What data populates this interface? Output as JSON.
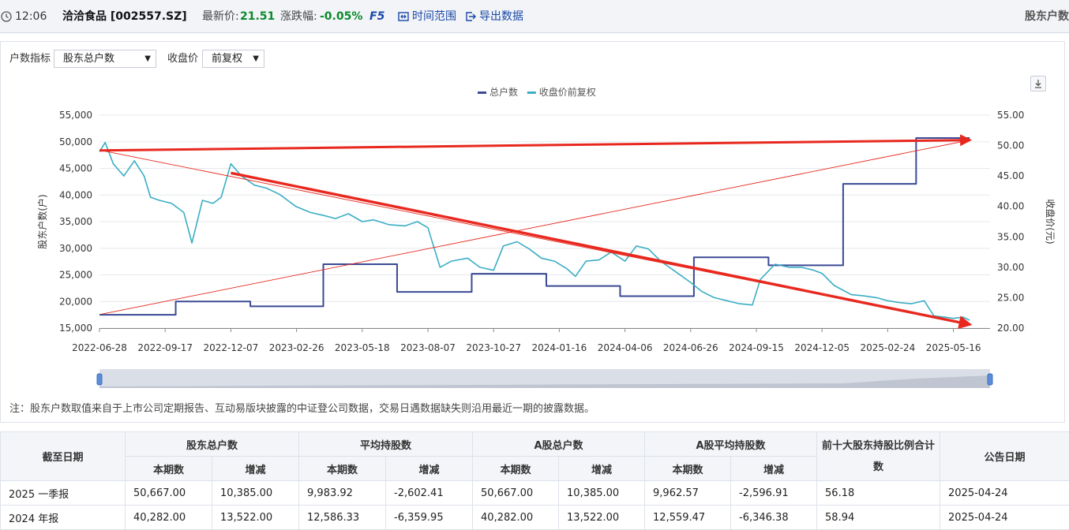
{
  "topbar": {
    "time": "12:06",
    "stock": "洽洽食品 [002557.SZ]",
    "latest_label": "最新价:",
    "latest_value": "21.51",
    "change_label": "涨跌幅:",
    "change_value": "-0.05%",
    "f5": "F5",
    "time_range": "时间范围",
    "export": "导出数据",
    "right_title": "股东户数"
  },
  "controls": {
    "metric_label": "户数指标",
    "metric_value": "股东总户数",
    "price_label": "收盘价",
    "price_value": "前复权"
  },
  "chart_data": {
    "type": "line",
    "legend": [
      "总户数",
      "收盘价前复权"
    ],
    "legend_position": "top-center",
    "ylabel_left": "股东户数(户)",
    "ylabel_right": "收盘价(元)",
    "yticks_left": [
      "55,000",
      "50,000",
      "45,000",
      "40,000",
      "35,000",
      "30,000",
      "25,000",
      "20,000",
      "15,000"
    ],
    "yticks_right": [
      "55.00",
      "50.00",
      "45.00",
      "40.00",
      "35.00",
      "30.00",
      "25.00",
      "20.00"
    ],
    "xticks": [
      "2022-06-28",
      "2022-09-17",
      "2022-12-07",
      "2023-02-26",
      "2023-05-18",
      "2023-08-07",
      "2023-10-27",
      "2024-01-16",
      "2024-04-06",
      "2024-06-26",
      "2024-09-15",
      "2024-12-05",
      "2025-02-24",
      "2025-05-16"
    ],
    "ylim_left": [
      15000,
      55000
    ],
    "ylim_right": [
      20,
      55
    ],
    "grid": true,
    "series": [
      {
        "name": "总户数",
        "axis": "left",
        "style": "step",
        "color": "#3a4a94",
        "points": [
          [
            "2022-06-28",
            17500
          ],
          [
            "2022-09-30",
            20000
          ],
          [
            "2022-12-31",
            19100
          ],
          [
            "2023-03-31",
            27000
          ],
          [
            "2023-06-30",
            21800
          ],
          [
            "2023-09-30",
            25200
          ],
          [
            "2023-12-31",
            22900
          ],
          [
            "2024-03-31",
            21000
          ],
          [
            "2024-06-30",
            28300
          ],
          [
            "2024-09-30",
            26800
          ],
          [
            "2024-12-31",
            42100
          ],
          [
            "2025-03-31",
            50700
          ],
          [
            "2025-06-05",
            50700
          ]
        ]
      },
      {
        "name": "收盘价前复权",
        "axis": "right",
        "color": "#3aaec4",
        "points": [
          [
            "2022-06-28",
            49.0
          ],
          [
            "2022-07-05",
            50.5
          ],
          [
            "2022-07-15",
            47.0
          ],
          [
            "2022-07-28",
            45.0
          ],
          [
            "2022-08-10",
            47.5
          ],
          [
            "2022-08-22",
            45.0
          ],
          [
            "2022-08-30",
            41.5
          ],
          [
            "2022-09-10",
            41.0
          ],
          [
            "2022-09-25",
            40.5
          ],
          [
            "2022-10-10",
            39.0
          ],
          [
            "2022-10-20",
            34.0
          ],
          [
            "2022-11-02",
            41.0
          ],
          [
            "2022-11-15",
            40.5
          ],
          [
            "2022-11-25",
            41.5
          ],
          [
            "2022-12-07",
            47.0
          ],
          [
            "2022-12-20",
            45.0
          ],
          [
            "2023-01-05",
            43.5
          ],
          [
            "2023-01-20",
            43.0
          ],
          [
            "2023-02-05",
            42.0
          ],
          [
            "2023-02-25",
            40.0
          ],
          [
            "2023-03-15",
            39.0
          ],
          [
            "2023-04-01",
            38.5
          ],
          [
            "2023-04-15",
            38.0
          ],
          [
            "2023-05-01",
            38.8
          ],
          [
            "2023-05-18",
            37.5
          ],
          [
            "2023-06-01",
            37.8
          ],
          [
            "2023-06-20",
            37.0
          ],
          [
            "2023-07-10",
            36.8
          ],
          [
            "2023-07-25",
            37.5
          ],
          [
            "2023-08-07",
            36.5
          ],
          [
            "2023-08-15",
            33.0
          ],
          [
            "2023-08-22",
            30.0
          ],
          [
            "2023-09-05",
            31.0
          ],
          [
            "2023-09-25",
            31.5
          ],
          [
            "2023-10-10",
            30.0
          ],
          [
            "2023-10-27",
            29.5
          ],
          [
            "2023-11-08",
            33.5
          ],
          [
            "2023-11-25",
            34.2
          ],
          [
            "2023-12-10",
            33.0
          ],
          [
            "2023-12-25",
            31.5
          ],
          [
            "2024-01-10",
            31.0
          ],
          [
            "2024-01-25",
            29.8
          ],
          [
            "2024-02-05",
            28.5
          ],
          [
            "2024-02-18",
            31.0
          ],
          [
            "2024-03-05",
            31.2
          ],
          [
            "2024-03-20",
            32.5
          ],
          [
            "2024-04-06",
            31.0
          ],
          [
            "2024-04-20",
            33.5
          ],
          [
            "2024-05-05",
            33.0
          ],
          [
            "2024-05-20",
            31.0
          ],
          [
            "2024-06-05",
            29.5
          ],
          [
            "2024-06-26",
            27.5
          ],
          [
            "2024-07-10",
            26.0
          ],
          [
            "2024-07-25",
            25.0
          ],
          [
            "2024-08-10",
            24.5
          ],
          [
            "2024-08-25",
            24.0
          ],
          [
            "2024-09-10",
            23.8
          ],
          [
            "2024-09-20",
            28.0
          ],
          [
            "2024-10-08",
            30.5
          ],
          [
            "2024-10-25",
            30.0
          ],
          [
            "2024-11-10",
            30.0
          ],
          [
            "2024-11-25",
            29.5
          ],
          [
            "2024-12-05",
            29.0
          ],
          [
            "2024-12-20",
            27.0
          ],
          [
            "2025-01-10",
            25.5
          ],
          [
            "2025-01-25",
            25.3
          ],
          [
            "2025-02-10",
            25.0
          ],
          [
            "2025-02-24",
            24.5
          ],
          [
            "2025-03-10",
            24.2
          ],
          [
            "2025-03-25",
            24.0
          ],
          [
            "2025-04-10",
            24.5
          ],
          [
            "2025-04-22",
            22.0
          ],
          [
            "2025-05-05",
            21.8
          ],
          [
            "2025-05-16",
            21.6
          ],
          [
            "2025-05-28",
            21.8
          ],
          [
            "2025-06-05",
            21.3
          ]
        ]
      }
    ],
    "annotations": [
      {
        "type": "arrow",
        "color": "#e8281e",
        "from": [
          "2022-06-28",
          49.2
        ],
        "to": [
          "2025-06-05",
          50.9
        ],
        "axis": "mixed"
      },
      {
        "type": "arrow",
        "color": "#e8281e",
        "from": [
          "2022-12-07",
          45.5
        ],
        "to": [
          "2025-06-05",
          20.6
        ],
        "axis": "right"
      }
    ]
  },
  "note": "注：股东户数取值来自于上市公司定期报告、互动易版块披露的中证登公司数据，交易日遇数据缺失则沿用最近一期的披露数据。",
  "table": {
    "headers_top": [
      "截至日期",
      "股东总户数",
      "平均持股数",
      "A股总户数",
      "A股平均持股数",
      "前十大股东持股比例合计数",
      "公告日期"
    ],
    "sub_headers": [
      "本期数",
      "增减",
      "本期数",
      "增减",
      "本期数",
      "增减",
      "本期数",
      "增减"
    ],
    "rows": [
      [
        "2025 一季报",
        "50,667.00",
        "10,385.00",
        "9,983.92",
        "-2,602.41",
        "50,667.00",
        "10,385.00",
        "9,962.57",
        "-2,596.91",
        "56.18",
        "2025-04-24"
      ],
      [
        "2024 年报",
        "40,282.00",
        "13,522.00",
        "12,586.33",
        "-6,359.95",
        "40,282.00",
        "13,522.00",
        "12,559.47",
        "-6,346.38",
        "58.94",
        "2025-04-24"
      ]
    ]
  }
}
